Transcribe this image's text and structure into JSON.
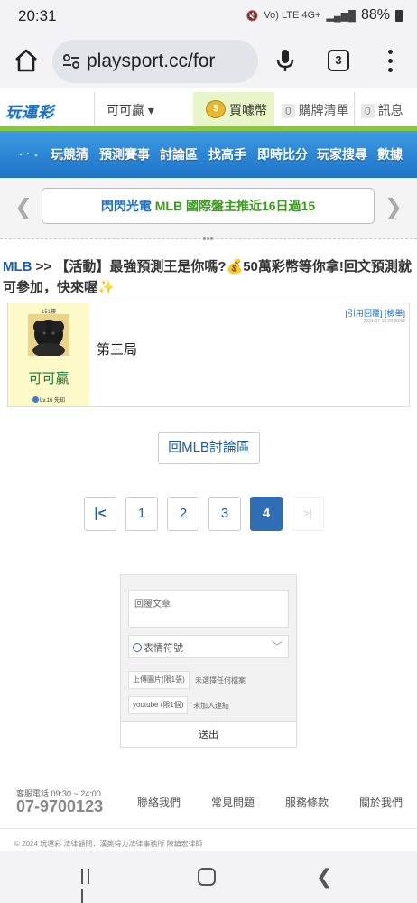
{
  "status_bar": {
    "time": "20:31",
    "network": "Vo) LTE 4G+",
    "battery": "88%"
  },
  "browser": {
    "url": "playsport.cc/for",
    "tab_count": "3"
  },
  "site_header": {
    "logo": "玩運彩",
    "user_dropdown": "可可贏 ▾",
    "coin_button": "買噱幣",
    "cart": {
      "count": "0",
      "label": "購牌清單"
    },
    "messages": {
      "count": "0",
      "label": "訊息"
    }
  },
  "nav": {
    "items": [
      "玩競猜",
      "預測賽事",
      "討論區",
      "找高手",
      "即時比分",
      "玩家搜尋",
      "數據"
    ]
  },
  "banner": {
    "part1": "閃閃光電",
    "part2": "MLB 國際盤主推近16日過15"
  },
  "topic": {
    "category": "MLB",
    "separator": " >> ",
    "title": "【活動】最強預測王是你嗎?💰50萬彩幣等你拿!回文預測就可參加，快來喔✨"
  },
  "post": {
    "floor": "151樓",
    "username": "可可贏",
    "level": "Lv.16 先知",
    "content": "第三局",
    "quote_action": "[引用回覆]",
    "report_action": "[檢舉]",
    "timestamp": "2024-07-16 20:30:52"
  },
  "back_button": "回MLB討論區",
  "pagination": {
    "first": "|<",
    "pages": [
      "1",
      "2",
      "3",
      "4"
    ],
    "current": "4",
    "last": ">|"
  },
  "reply_form": {
    "textarea_placeholder": "回覆文章",
    "emoji_label": "表情符號",
    "image_button": "上傳圖片(限1張)",
    "image_note": "未選擇任何檔案",
    "youtube_button": "youtube (限1個)",
    "youtube_note": "未加入連結",
    "submit": "送出"
  },
  "footer": {
    "service_label": "客服電話 09:30 ~ 24:00",
    "phone": "07-9700123",
    "links": [
      "聯絡我們",
      "常見問題",
      "服務條款",
      "關於我們"
    ],
    "copyright": "© 2024 玩運彩 法律顧問：漢英得力法律事務所 陳鎮宏律師"
  },
  "colors": {
    "nav_blue": "#1d73c6",
    "accent_green": "#8cc63f",
    "active_page": "#2f6db4",
    "post_side": "#fdf9c9"
  }
}
